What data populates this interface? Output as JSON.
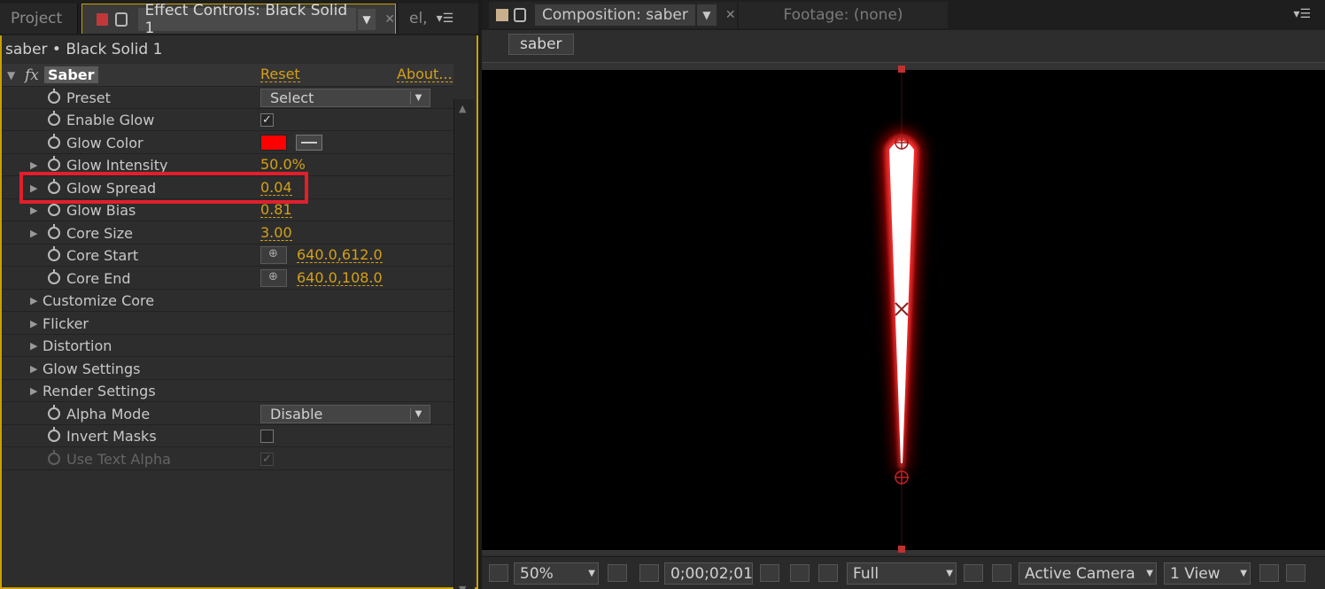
{
  "left_panel": {
    "tabs": {
      "project": "Project",
      "effect_controls": "Effect Controls: Black Solid 1",
      "other": "el,"
    },
    "layer_path": "saber • Black Solid 1",
    "effect": {
      "name": "Saber",
      "fx_icon": "fx",
      "reset": "Reset",
      "about": "About..."
    },
    "properties": {
      "preset": {
        "label": "Preset",
        "value": "Select"
      },
      "enable_glow": {
        "label": "Enable Glow",
        "checked": "✓"
      },
      "glow_color": {
        "label": "Glow Color",
        "color": "#ff0000"
      },
      "glow_intensity": {
        "label": "Glow Intensity",
        "value": "50.0%"
      },
      "glow_spread": {
        "label": "Glow Spread",
        "value": "0.04"
      },
      "glow_bias": {
        "label": "Glow Bias",
        "value": "0.81"
      },
      "core_size": {
        "label": "Core Size",
        "value": "3.00"
      },
      "core_start": {
        "label": "Core Start",
        "value": "640.0,612.0"
      },
      "core_end": {
        "label": "Core End",
        "value": "640.0,108.0"
      },
      "customize_core": {
        "label": "Customize Core"
      },
      "flicker": {
        "label": "Flicker"
      },
      "distortion": {
        "label": "Distortion"
      },
      "glow_settings": {
        "label": "Glow Settings"
      },
      "render_settings": {
        "label": "Render Settings"
      },
      "alpha_mode": {
        "label": "Alpha Mode",
        "value": "Disable"
      },
      "invert_masks": {
        "label": "Invert Masks"
      },
      "use_text_alpha": {
        "label": "Use Text Alpha",
        "checked": "✓"
      }
    }
  },
  "right_panel": {
    "tabs": {
      "composition": "Composition: saber",
      "footage": "Footage: (none)"
    },
    "comp_button": "saber",
    "bottom_bar": {
      "zoom": "50%",
      "timecode": "0;00;02;01",
      "resolution": "Full",
      "camera": "Active Camera",
      "views": "1 View"
    }
  },
  "colors": {
    "accent": "#d4a017",
    "highlight": "#e0202c",
    "glow": "#ff0000"
  }
}
